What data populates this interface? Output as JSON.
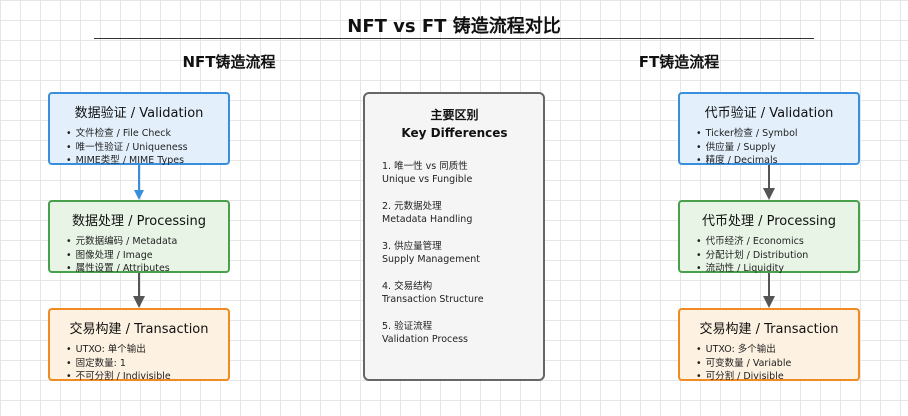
{
  "title": "NFT vs FT 铸造流程对比",
  "nft": {
    "heading": "NFT铸造流程",
    "validation": {
      "title": "数据验证 / Validation",
      "items": [
        "文件检查 / File Check",
        "唯一性验证 / Uniqueness",
        "MIME类型 / MIME Types"
      ]
    },
    "processing": {
      "title": "数据处理 / Processing",
      "items": [
        "元数据编码 / Metadata",
        "图像处理 / Image",
        "属性设置 / Attributes"
      ]
    },
    "transaction": {
      "title": "交易构建 / Transaction",
      "items": [
        "UTXO: 单个输出",
        "固定数量: 1",
        "不可分割 / Indivisible"
      ]
    }
  },
  "ft": {
    "heading": "FT铸造流程",
    "validation": {
      "title": "代币验证 / Validation",
      "items": [
        "Ticker检查 / Symbol",
        "供应量 / Supply",
        "精度 / Decimals"
      ]
    },
    "processing": {
      "title": "代币处理 / Processing",
      "items": [
        "代币经济 / Economics",
        "分配计划 / Distribution",
        "流动性 / Liquidity"
      ]
    },
    "transaction": {
      "title": "交易构建 / Transaction",
      "items": [
        "UTXO: 多个输出",
        "可变数量 / Variable",
        "可分割 / Divisible"
      ]
    }
  },
  "key": {
    "title_zh": "主要区别",
    "title_en": "Key Differences",
    "items": [
      {
        "zh": "1. 唯一性 vs 同质性",
        "en": "Unique vs Fungible"
      },
      {
        "zh": "2. 元数据处理",
        "en": "Metadata Handling"
      },
      {
        "zh": "3. 供应量管理",
        "en": "Supply Management"
      },
      {
        "zh": "4. 交易结构",
        "en": "Transaction Structure"
      },
      {
        "zh": "5. 验证流程",
        "en": "Validation Process"
      }
    ]
  },
  "colors": {
    "validation": "#3a8fdc",
    "processing": "#49a04c",
    "transaction": "#ef8b22",
    "arrow": "#555555"
  }
}
